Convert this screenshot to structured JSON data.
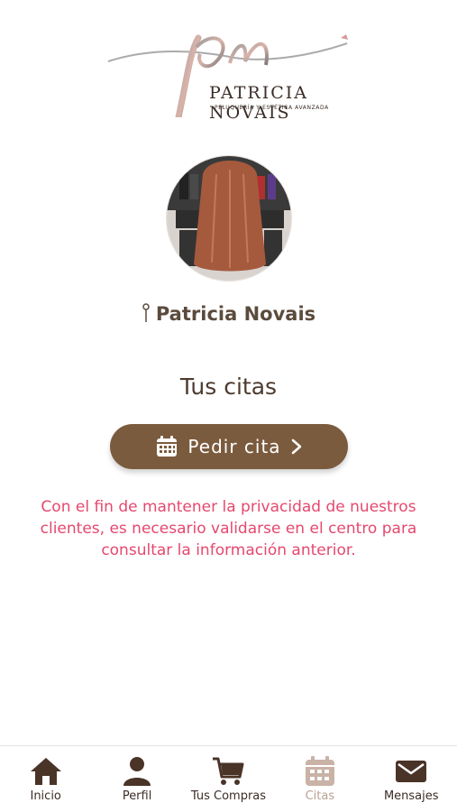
{
  "brand": {
    "name": "PATRICIA NOVAIS",
    "tagline": "PELUQUERÍA Y ESTÉTICA AVANZADA"
  },
  "location": {
    "name": "Patricia Novais"
  },
  "appointments": {
    "title": "Tus citas",
    "request_button": "Pedir cita",
    "privacy_notice": "Con el fin de mantener la privacidad de nuestros clientes, es necesario validarse en el centro para consultar la información anterior."
  },
  "tabs": [
    {
      "label": "Inicio",
      "icon": "home-icon"
    },
    {
      "label": "Perfil",
      "icon": "user-icon"
    },
    {
      "label": "Tus Compras",
      "icon": "cart-icon"
    },
    {
      "label": "Citas",
      "icon": "calendar-icon",
      "active": true
    },
    {
      "label": "Mensajes",
      "icon": "mail-icon"
    }
  ],
  "colors": {
    "primary": "#7b5b3e",
    "notice": "#e5486e",
    "active_tab": "#b9a194"
  }
}
